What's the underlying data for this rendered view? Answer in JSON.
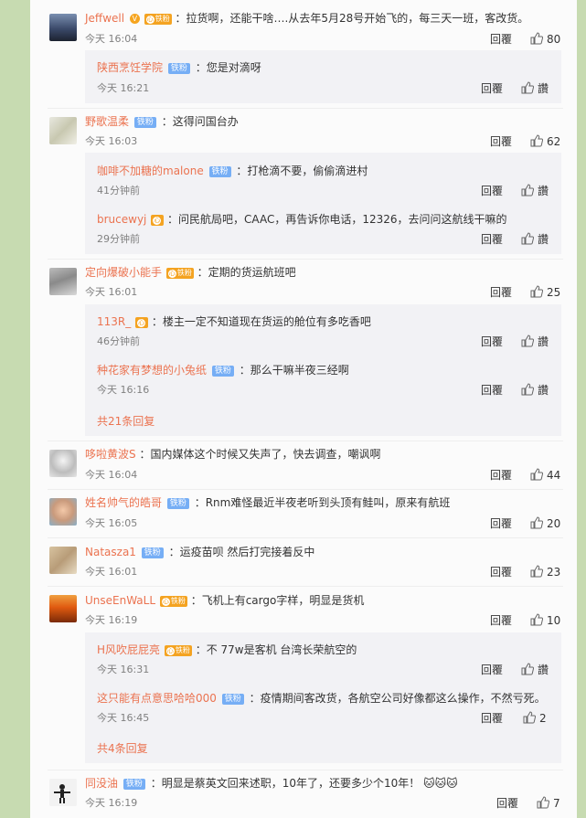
{
  "actions": {
    "reply": "回覆"
  },
  "badges": {
    "tiefen": "铁粉",
    "vip": "铁粉",
    "crown": "心"
  },
  "comments": [
    {
      "name": "Jeffwell",
      "text": "：拉货啊，还能干啥….从去年5月28号开始飞的，每三天一班，客改货。",
      "time": "今天 16:04",
      "likes": "80",
      "replies": [
        {
          "name": "陕西烹饪学院",
          "text": "：您是对滴呀",
          "time": "今天 16:21",
          "like_label": "讚"
        }
      ]
    },
    {
      "name": "野歌温柔",
      "text": "：这得问国台办",
      "time": "今天 16:03",
      "likes": "62",
      "replies": [
        {
          "name": "咖啡不加糖的malone",
          "text": "：打枪滴不要，偷偷滴进村",
          "time": "41分钟前",
          "like_label": "讚"
        },
        {
          "name": "brucewyj",
          "text": "：问民航局吧，CAAC，再告诉你电话，12326，去问问这航线干嘛的",
          "time": "29分钟前",
          "like_label": "讚"
        }
      ]
    },
    {
      "name": "定向爆破小能手",
      "text": "：定期的货运航班吧",
      "time": "今天 16:01",
      "likes": "25",
      "replies": [
        {
          "name": "113R_",
          "text": "：楼主一定不知道现在货运的舱位有多吃香吧",
          "time": "46分钟前",
          "like_label": "讚"
        },
        {
          "name": "种花家有梦想的小兔纸",
          "text": "：那么干嘛半夜三经啊",
          "time": "今天 16:16",
          "like_label": "讚"
        }
      ],
      "more": "共21条回复"
    },
    {
      "name": "哆啦黄波S",
      "text": "：国内媒体这个时候又失声了，快去调查，嘲讽啊",
      "time": "今天 16:04",
      "likes": "44"
    },
    {
      "name": "姓名帅气的皓哥",
      "text": "：Rnm难怪最近半夜老听到头顶有鲑叫，原来有航班",
      "time": "今天 16:05",
      "likes": "20"
    },
    {
      "name": "Natasza1",
      "text": "：运疫苗呗 然后打完接着反中",
      "time": "今天 16:01",
      "likes": "23"
    },
    {
      "name": "UnseEnWaLL",
      "text": "：飞机上有cargo字样，明显是货机",
      "time": "今天 16:19",
      "likes": "10",
      "replies": [
        {
          "name": "H风吹屁屁亮",
          "text": "：不 77w是客机 台湾长荣航空的",
          "time": "今天 16:31",
          "like_label": "讚"
        },
        {
          "name": "这只能有点意思哈哈000",
          "text": "：疫情期间客改货，各航空公司好像都这么操作，不然亏死。",
          "time": "今天 16:45",
          "likes": "2"
        }
      ],
      "more": "共4条回复"
    },
    {
      "name": "同没油",
      "text": "：明显是蔡英文回来述职，10年了，还要多少个10年！",
      "time": "今天 16:19",
      "likes": "7"
    }
  ],
  "emoji": "🐱",
  "icons": {
    "thumb": "thumbs-up-icon",
    "verified": "verified-v-icon"
  }
}
